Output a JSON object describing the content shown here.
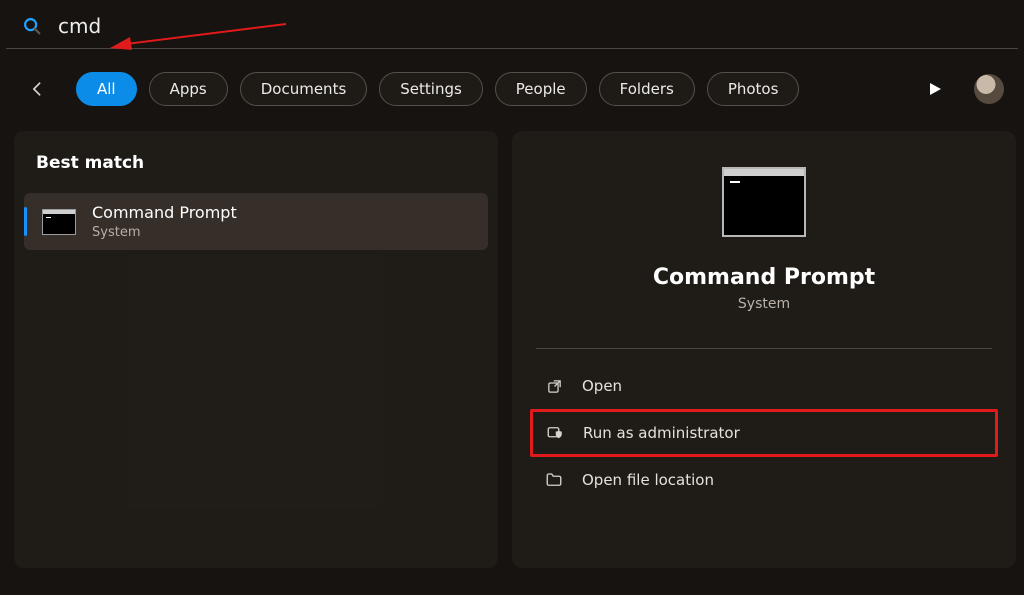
{
  "search": {
    "value": "cmd"
  },
  "filters": {
    "items": [
      {
        "label": "All",
        "active": true
      },
      {
        "label": "Apps",
        "active": false
      },
      {
        "label": "Documents",
        "active": false
      },
      {
        "label": "Settings",
        "active": false
      },
      {
        "label": "People",
        "active": false
      },
      {
        "label": "Folders",
        "active": false
      },
      {
        "label": "Photos",
        "active": false
      }
    ]
  },
  "left": {
    "section_label": "Best match",
    "result": {
      "title": "Command Prompt",
      "subtitle": "System"
    }
  },
  "right": {
    "title": "Command Prompt",
    "subtitle": "System",
    "actions": [
      {
        "label": "Open",
        "icon": "open-external-icon",
        "highlight": false
      },
      {
        "label": "Run as administrator",
        "icon": "admin-shield-icon",
        "highlight": true
      },
      {
        "label": "Open file location",
        "icon": "folder-icon",
        "highlight": false
      }
    ]
  },
  "annotation": {
    "arrow_color": "#e11b1b",
    "runas_outline_color": "#e11b1b"
  }
}
